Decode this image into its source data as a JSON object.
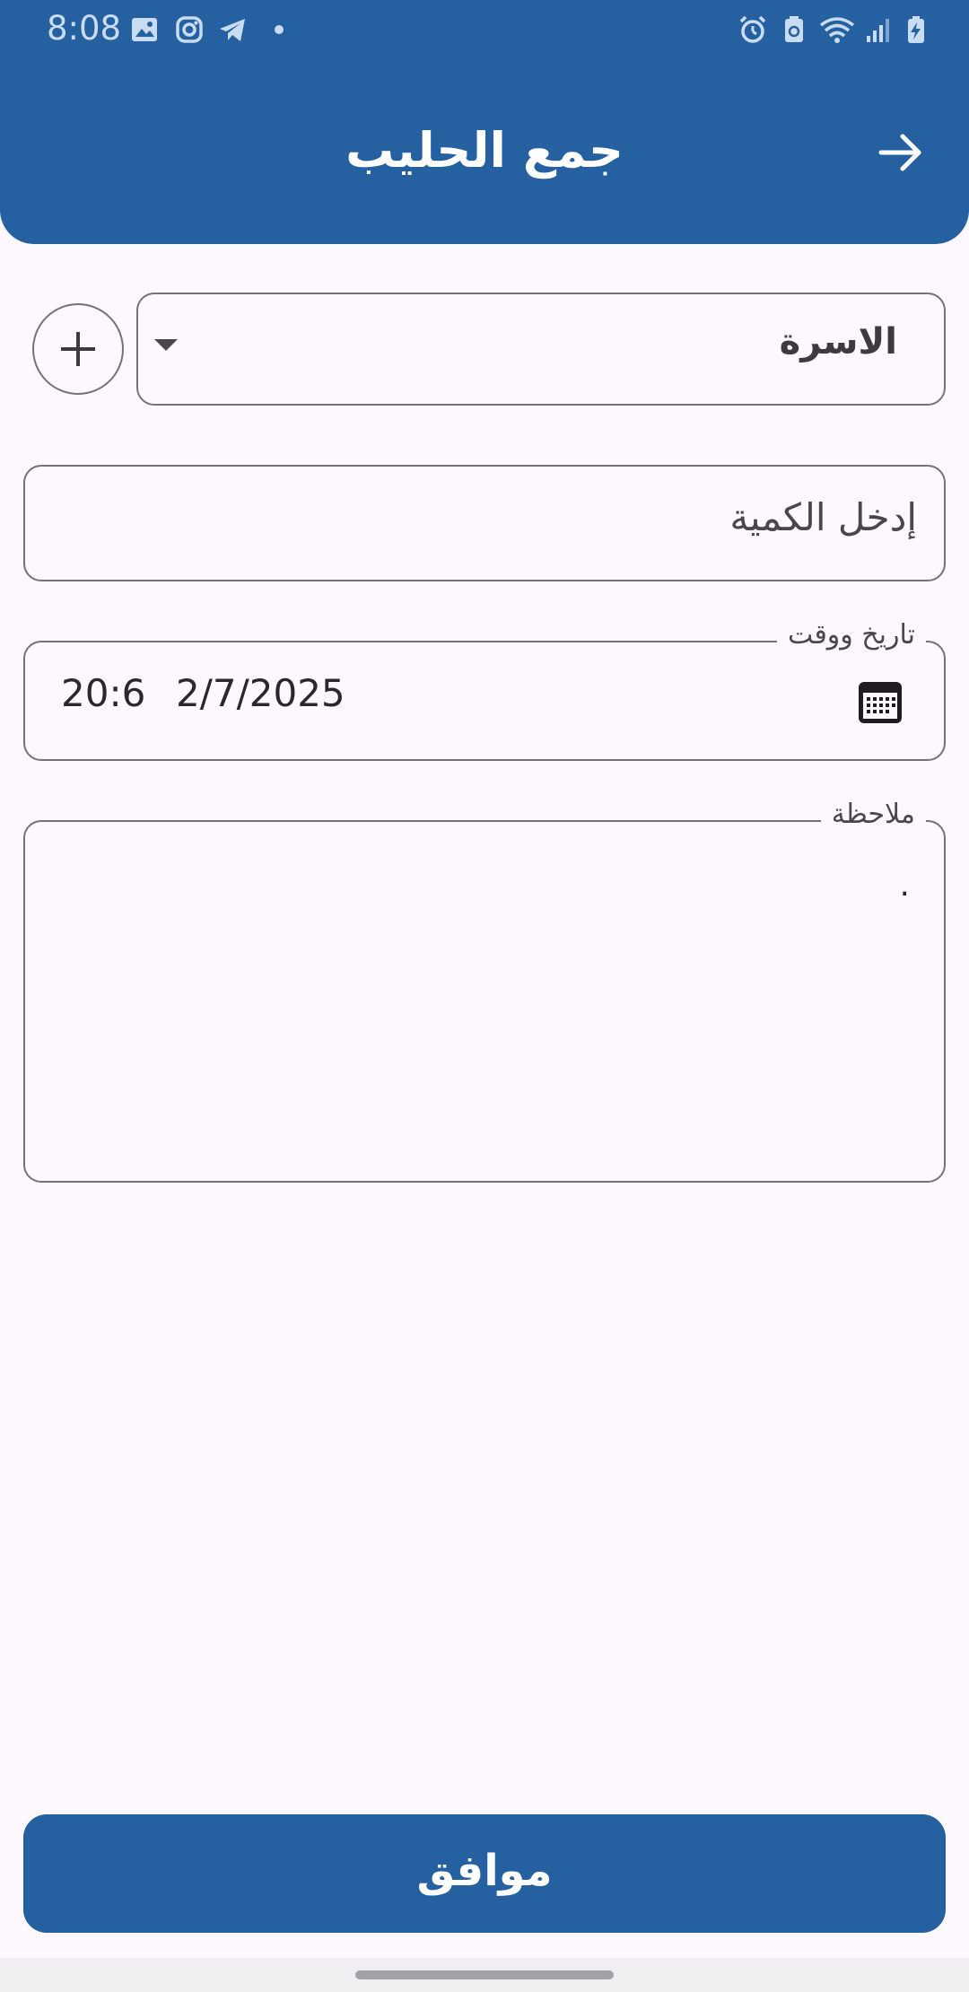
{
  "status_bar": {
    "time": "8:08",
    "left_icons": [
      "gallery-icon",
      "instagram-icon",
      "telegram-icon",
      "dot-icon"
    ],
    "right_icons": [
      "alarm-icon",
      "recycle-icon",
      "wifi-icon",
      "signal-icon",
      "battery-charging-icon"
    ]
  },
  "header": {
    "title": "جمع الحليب",
    "back_icon": "arrow-right-icon",
    "color": "#2561a0"
  },
  "form": {
    "family_select": {
      "value": "الاسرة"
    },
    "add_icon": "plus-icon",
    "quantity": {
      "placeholder": "إدخل الكمية"
    },
    "datetime": {
      "label": "تاريخ ووقت",
      "date": "2/7/2025",
      "time": "20:6",
      "icon": "calendar-icon"
    },
    "note": {
      "label": "ملاحظة",
      "value": "."
    }
  },
  "confirm_button": {
    "label": "موافق"
  }
}
